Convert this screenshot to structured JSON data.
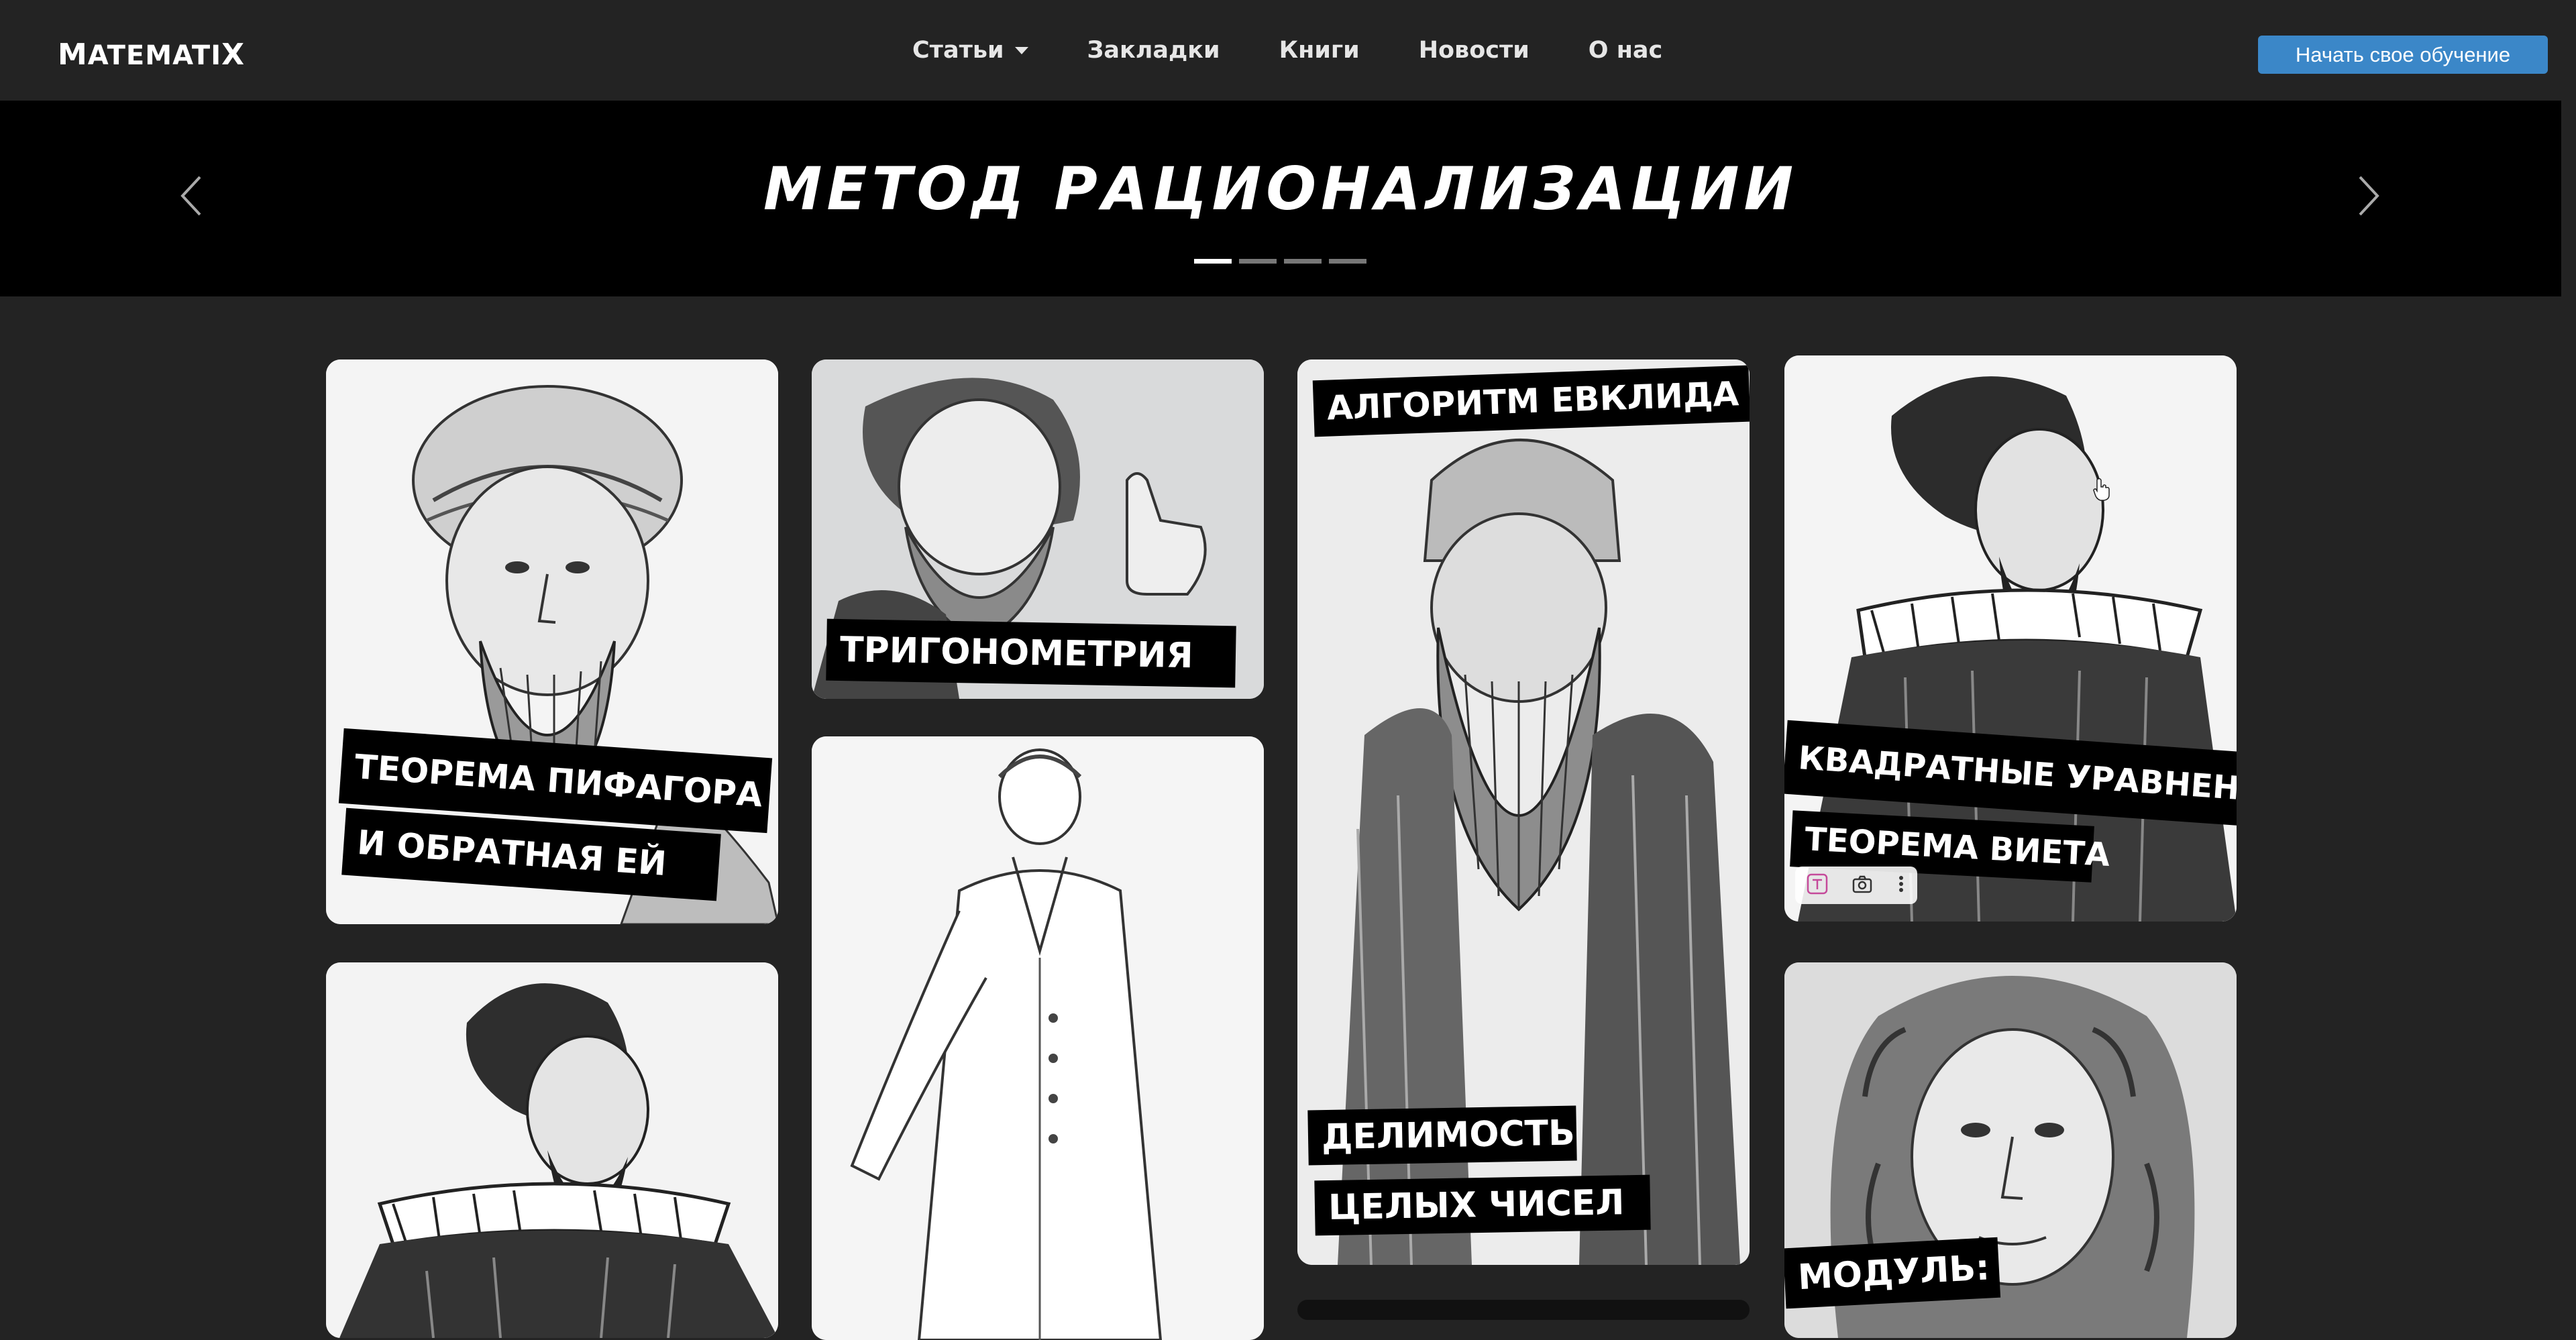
{
  "brand": {
    "first": "M",
    "rest": "ATEMATI",
    "last": "X"
  },
  "nav": {
    "items": [
      "Статьи",
      "Закладки",
      "Книги",
      "Новости",
      "О нас"
    ]
  },
  "cta": {
    "label": "Начать свое обучение"
  },
  "hero": {
    "title": "МЕТОД РАЦИОНАЛИЗАЦИИ",
    "slide_count": 4,
    "active_slide": 1
  },
  "cards": {
    "pythagoras": {
      "line1": "ТЕОРЕМА ПИФАГОРА",
      "line2": "И ОБРАТНАЯ ЕЙ"
    },
    "trig": {
      "line1": "ТРИГОНОМЕТРИЯ"
    },
    "euclid": {
      "top": "АЛГОРИТМ  ЕВКЛИДА",
      "line1": "ДЕЛИМОСТЬ",
      "line2": "ЦЕЛЫХ ЧИСЕЛ"
    },
    "viete": {
      "line1": "КВАДРАТНЫЕ УРАВНЕНИЯ",
      "line2": "ТЕОРЕМА ВИЕТА"
    },
    "modulus": {
      "line1": "МОДУЛЬ:"
    }
  },
  "icons": [
    "chevron-left-icon",
    "chevron-right-icon",
    "text-icon",
    "camera-icon",
    "more-vertical-icon",
    "hand-cursor-icon"
  ],
  "colors": {
    "background": "#232323",
    "hero": "#000000",
    "accent": "#3b87c8"
  }
}
